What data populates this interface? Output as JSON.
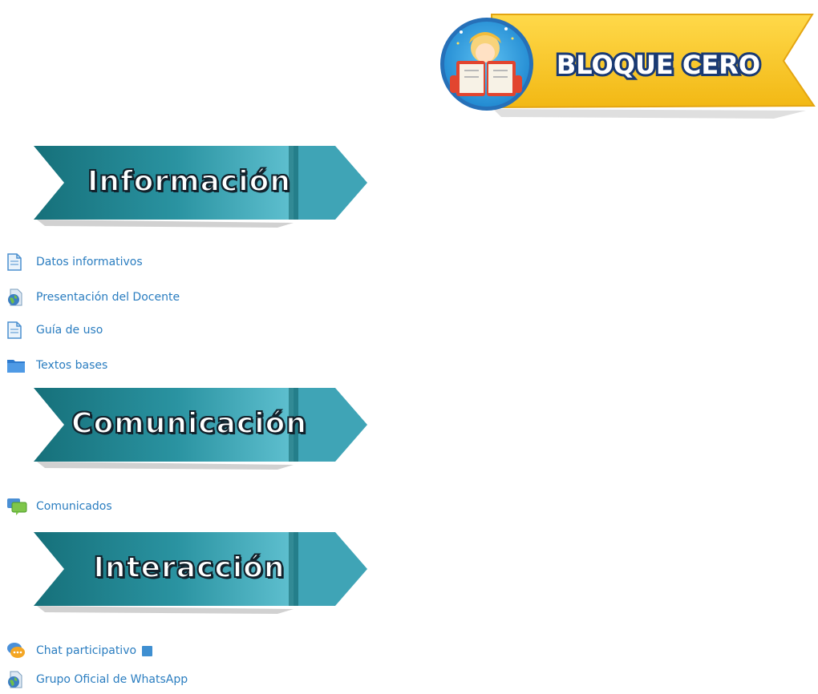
{
  "header": {
    "banner_text": "BLOQUE CERO",
    "colors": {
      "yellow": "#f5c223",
      "circle": "#2f9be0",
      "text_outline": "#1a3a73"
    }
  },
  "sections": [
    {
      "title": "Información",
      "items": [
        {
          "label": "Datos informativos",
          "icon": "page-icon"
        },
        {
          "label": "Presentación del Docente",
          "icon": "url-globe-icon"
        },
        {
          "label": "Guía de uso",
          "icon": "page-icon"
        },
        {
          "label": "Textos bases",
          "icon": "folder-icon"
        }
      ]
    },
    {
      "title": "Comunicación",
      "items": [
        {
          "label": "Comunicados",
          "icon": "forum-icon"
        }
      ]
    },
    {
      "title": "Interacción",
      "items": [
        {
          "label": "Chat participativo",
          "icon": "chat-icon"
        },
        {
          "label": "Grupo Oficial de WhatsApp",
          "icon": "url-globe-icon"
        }
      ]
    }
  ],
  "theme": {
    "ribbon_dark": "#0f5f66",
    "ribbon_mid": "#2a8f9c",
    "ribbon_light": "#4fb1c5",
    "link": "#2a7dc0"
  }
}
